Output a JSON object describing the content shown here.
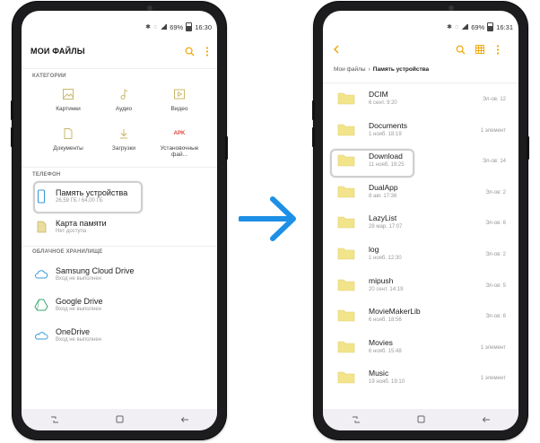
{
  "left": {
    "status_time": "16:30",
    "status_battery": "69%",
    "title": "МОИ ФАЙЛЫ",
    "sections": {
      "categories": "КАТЕГОРИИ",
      "phone": "ТЕЛЕФОН",
      "cloud": "ОБЛАЧНОЕ ХРАНИЛИЩЕ"
    },
    "categories": [
      {
        "label": "Картинки",
        "icon": "image-icon"
      },
      {
        "label": "Аудио",
        "icon": "music-note-icon"
      },
      {
        "label": "Видео",
        "icon": "video-icon"
      },
      {
        "label": "Документы",
        "icon": "document-icon"
      },
      {
        "label": "Загрузки",
        "icon": "download-icon"
      },
      {
        "label": "Установочные фай...",
        "icon": "apk-icon",
        "icon_text": "APK"
      }
    ],
    "storage": [
      {
        "name": "Память устройства",
        "detail": "26,59 ГБ / 64,00 ГБ",
        "icon": "phone-icon"
      },
      {
        "name": "Карта памяти",
        "detail": "Нет доступа",
        "icon": "sd-card-icon"
      }
    ],
    "cloud": [
      {
        "name": "Samsung Cloud Drive",
        "detail": "Вход не выполнен",
        "icon": "cloud-icon"
      },
      {
        "name": "Google Drive",
        "detail": "Вход не выполнен",
        "icon": "google-drive-icon"
      },
      {
        "name": "OneDrive",
        "detail": "Вход не выполнен",
        "icon": "onedrive-icon"
      }
    ]
  },
  "right": {
    "status_time": "16:31",
    "status_battery": "69%",
    "breadcrumb": {
      "root": "Мои файлы",
      "current": "Память устройства"
    },
    "folders": [
      {
        "name": "DCIM",
        "date": "6 сент. 9:20",
        "count": "Эл-ов: 12"
      },
      {
        "name": "Documents",
        "date": "1 нояб. 18:19",
        "count": "1 элемент"
      },
      {
        "name": "Download",
        "date": "11 нояб. 19:25",
        "count": "Эл-ов: 14"
      },
      {
        "name": "DualApp",
        "date": "8 авг. 17:36",
        "count": "Эл-ов: 2"
      },
      {
        "name": "LazyList",
        "date": "28 мар. 17:07",
        "count": "Эл-ов: 6"
      },
      {
        "name": "log",
        "date": "1 нояб. 12:30",
        "count": "Эл-ов: 2"
      },
      {
        "name": "mipush",
        "date": "20 сент. 14:19",
        "count": "Эл-ов: 5"
      },
      {
        "name": "MovieMakerLib",
        "date": "6 нояб. 18:56",
        "count": "Эл-ов: 6"
      },
      {
        "name": "Movies",
        "date": "6 нояб. 15:48",
        "count": "1 элемент"
      },
      {
        "name": "Music",
        "date": "19 нояб. 19:10",
        "count": "1 элемент"
      }
    ]
  },
  "colors": {
    "accent": "#f0a500",
    "icon": "#b0a060",
    "folder": "#f2e48a",
    "arrow": "#1d8fe6",
    "apk": "#e0443a"
  }
}
